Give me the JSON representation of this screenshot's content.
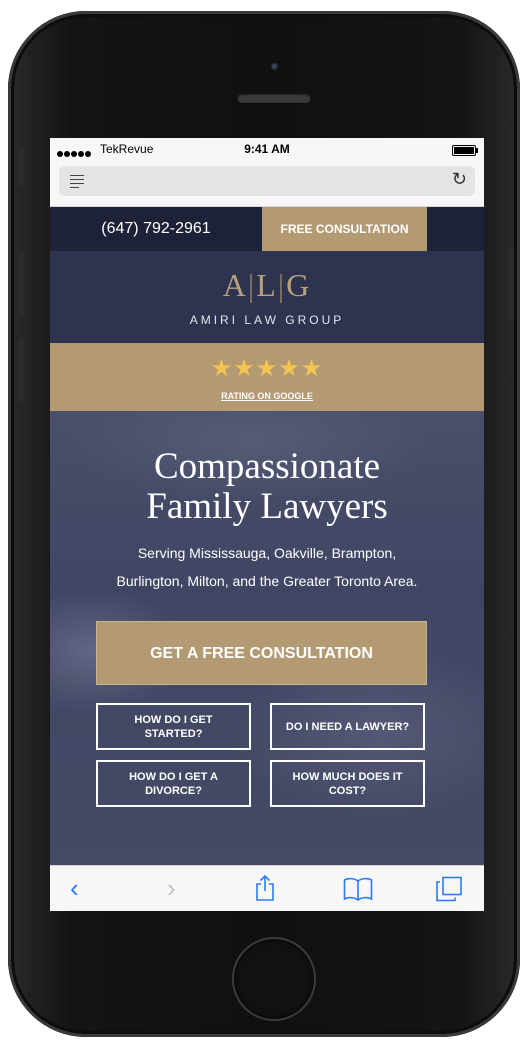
{
  "status_bar": {
    "carrier": "TekRevue",
    "time": "9:41 AM"
  },
  "site": {
    "topbar": {
      "phone": "(647) 792-2961",
      "consult_label": "FREE CONSULTATION"
    },
    "logo": {
      "letter_a": "A",
      "letter_l": "L",
      "letter_g": "G",
      "name": "AMIRI LAW GROUP"
    },
    "rating": {
      "stars": "★★★★★",
      "link": "RATING ON GOOGLE"
    },
    "hero": {
      "title_line1": "Compassionate",
      "title_line2": "Family Lawyers",
      "subtitle_line1": "Serving Mississauga, Oakville, Brampton,",
      "subtitle_line2": "Burlington, Milton, and the Greater Toronto Area.",
      "cta": "GET A FREE CONSULTATION",
      "questions": [
        "HOW DO I GET STARTED?",
        "DO I NEED A LAWYER?",
        "HOW DO I GET A DIVORCE?",
        "HOW MUCH DOES IT COST?"
      ]
    }
  },
  "toolbar": {
    "back": "‹",
    "forward": "›"
  },
  "colors": {
    "navy": "#1e2238",
    "logo_bg": "#2e3350",
    "gold": "#b39a72",
    "star": "#f4c451",
    "ios_blue": "#2d7bf4"
  }
}
